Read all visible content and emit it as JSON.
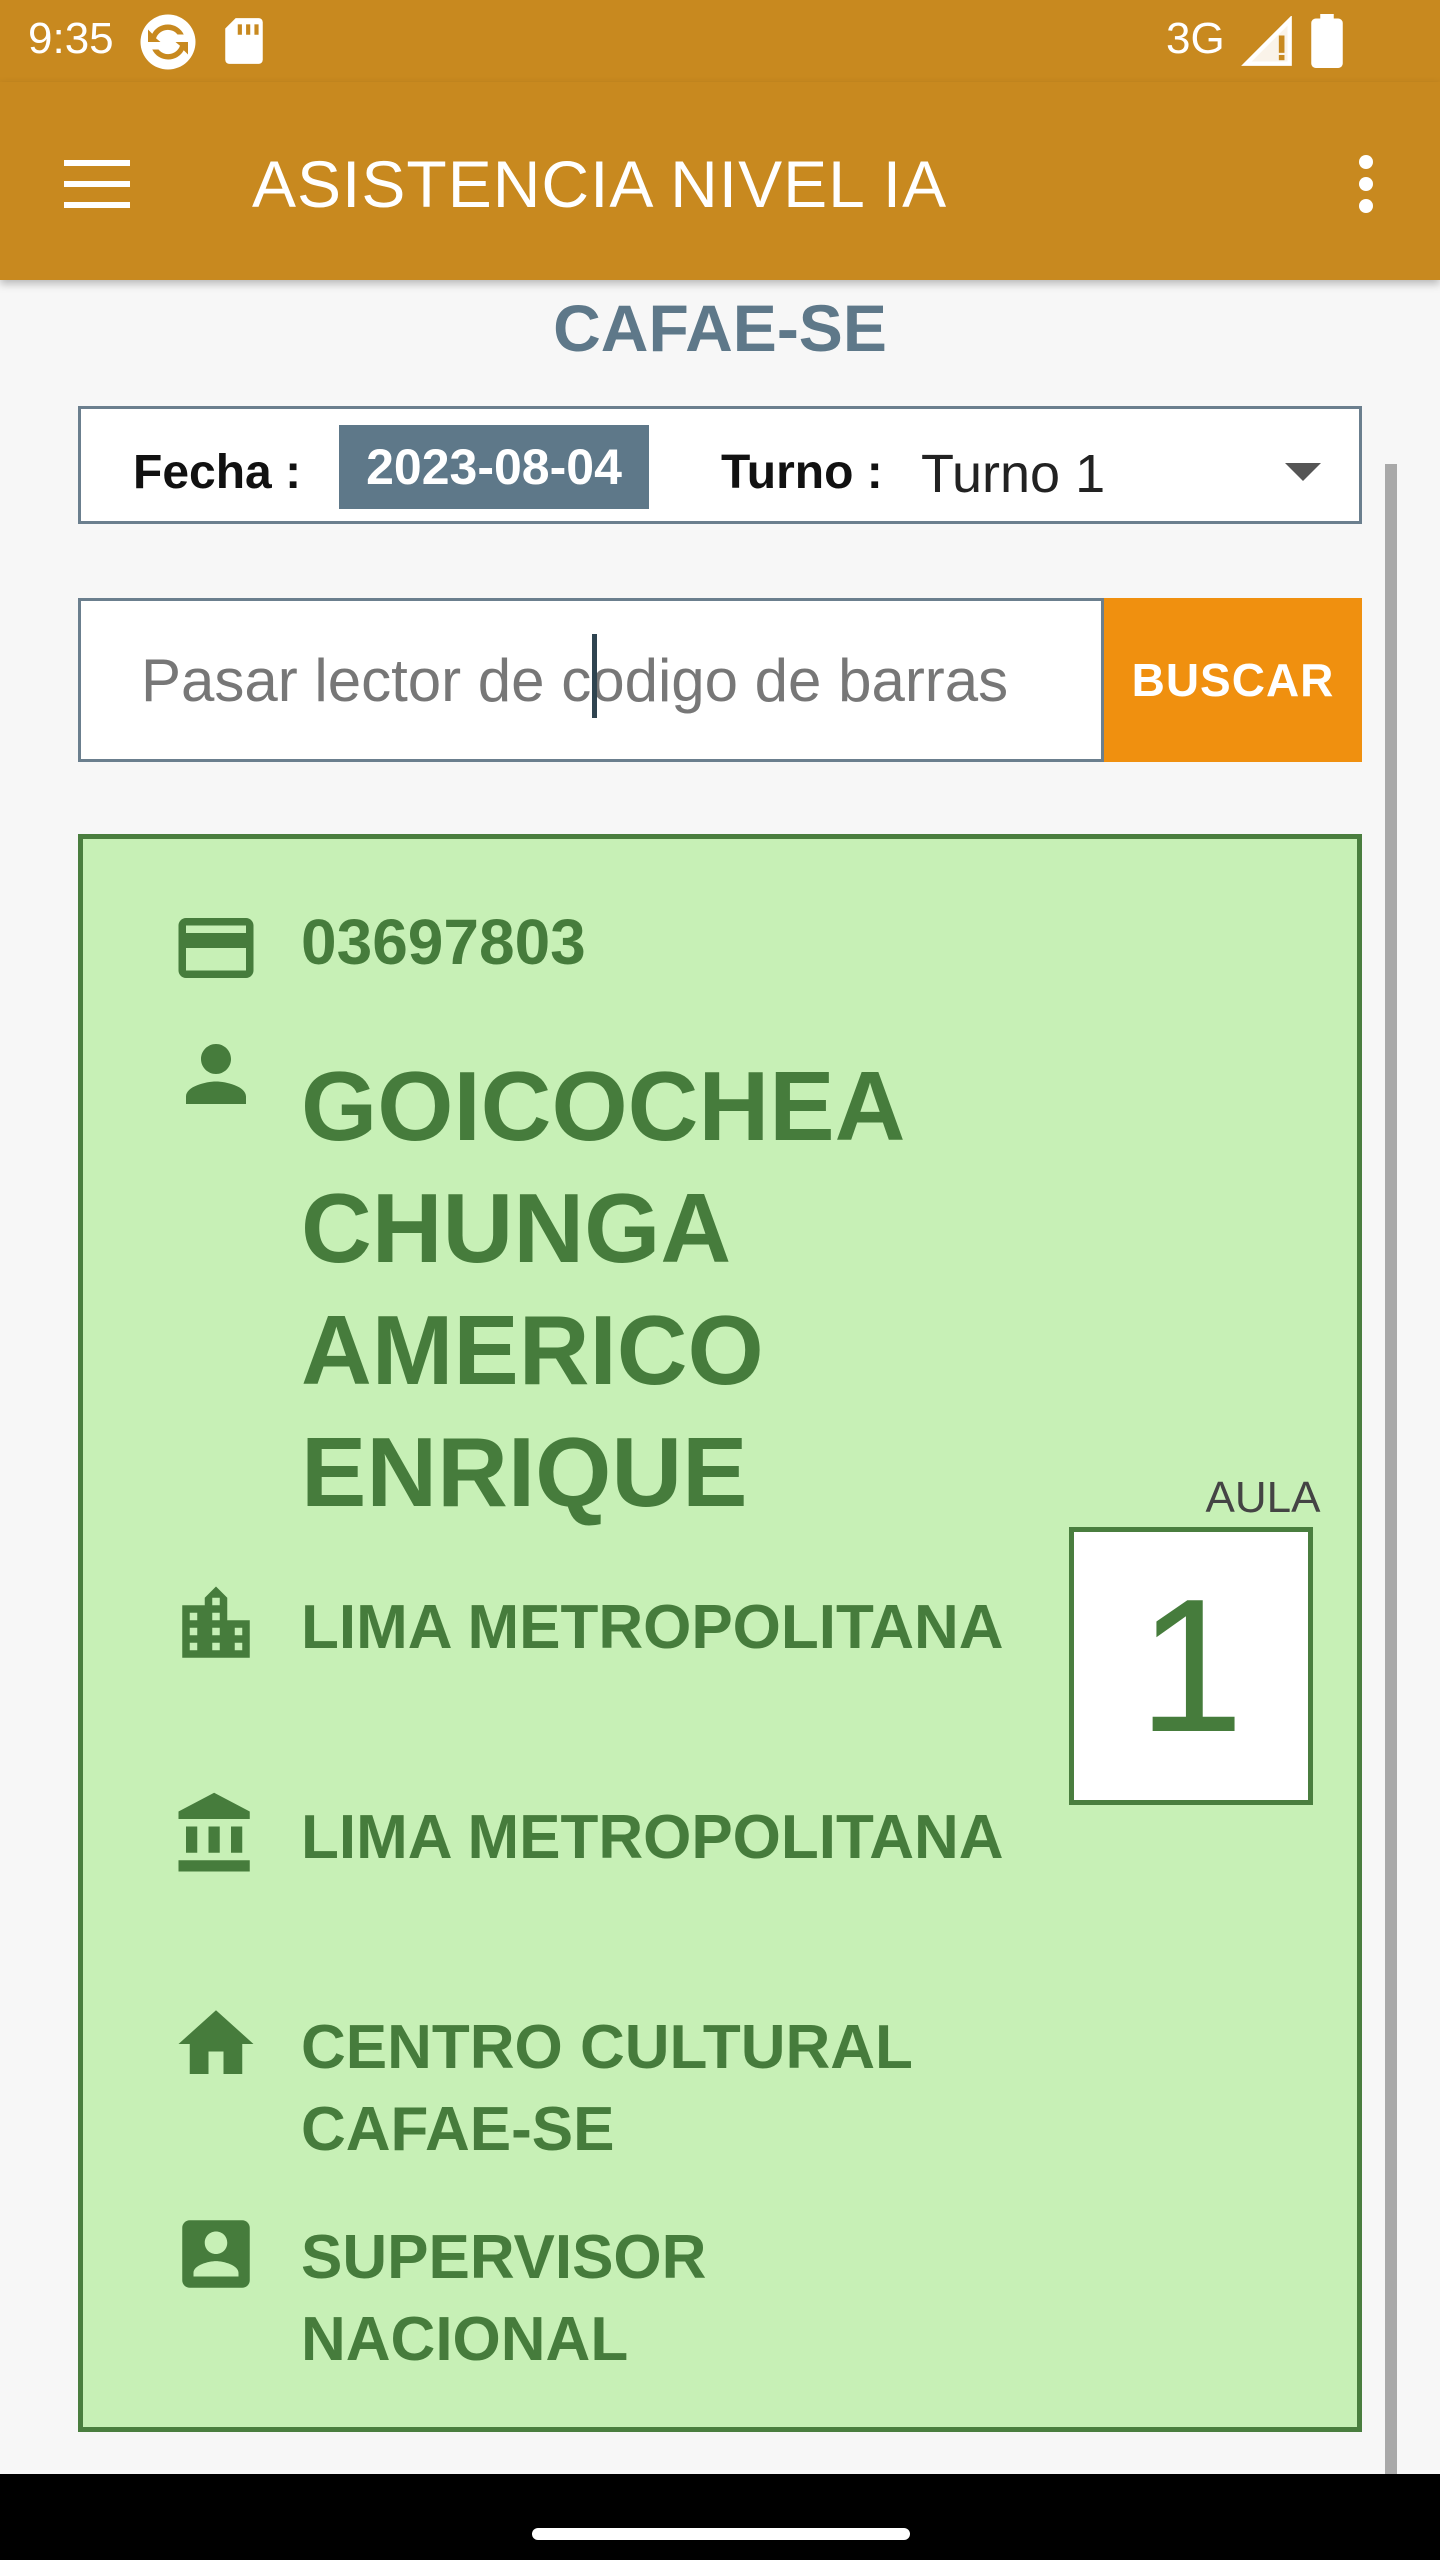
{
  "status_bar": {
    "time": "9:35",
    "network": "3G",
    "icons": [
      "sync-icon",
      "sd-card-icon",
      "signal-icon",
      "battery-icon"
    ]
  },
  "app_bar": {
    "title": "ASISTENCIA NIVEL IA",
    "menu_icon": "hamburger-menu-icon",
    "more_icon": "more-vert-icon",
    "color": "#c8891f"
  },
  "subtitle": "CAFAE-SE",
  "filters": {
    "fecha_label": "Fecha :",
    "fecha_value": "2023-08-04",
    "turno_label": "Turno :",
    "turno_value": "Turno 1"
  },
  "search": {
    "placeholder": "Pasar lector de codigo de barras",
    "button_label": "BUSCAR",
    "button_color": "#f0900f"
  },
  "result": {
    "dni": "03697803",
    "name": "GOICOCHEA CHUNGA AMERICO ENRIQUE",
    "region": "LIMA METROPOLITANA",
    "sede": "LIMA METROPOLITANA",
    "local": "CENTRO CULTURAL CAFAE-SE",
    "cargo": "SUPERVISOR NACIONAL",
    "aula_label": "AULA",
    "aula_number": "1",
    "card_color": "#c7f0b6",
    "text_color": "#467c3c"
  }
}
